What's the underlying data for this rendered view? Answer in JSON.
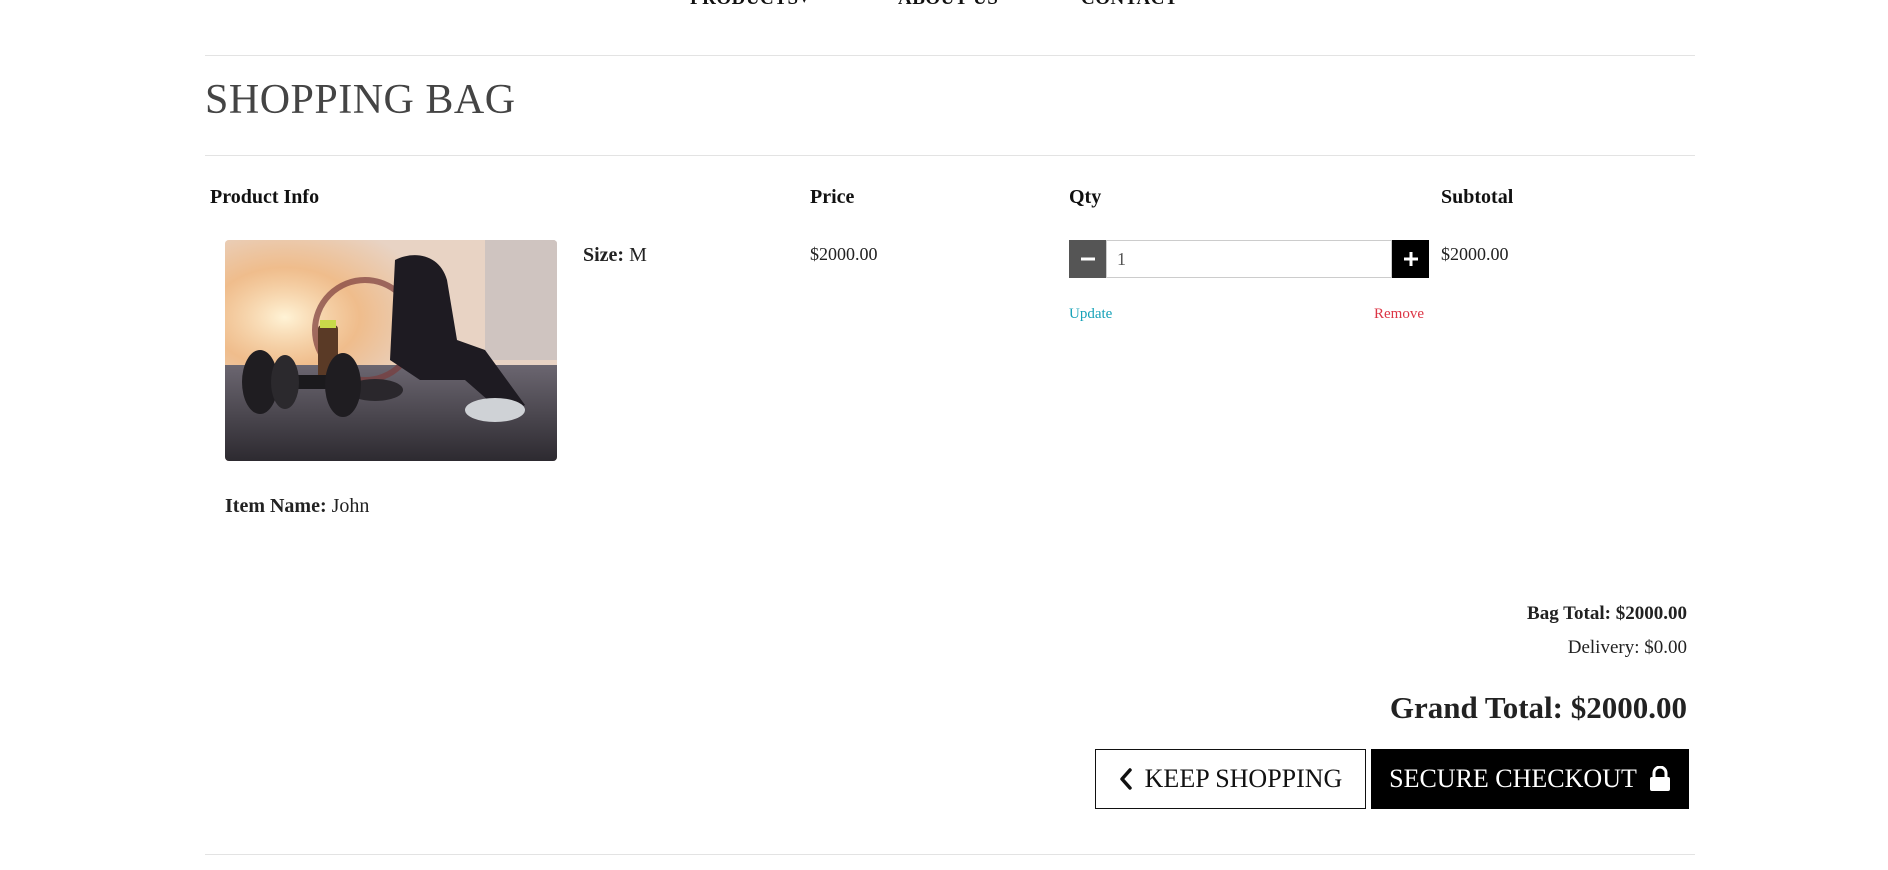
{
  "nav": {
    "items": [
      {
        "label": "PRODUCTS"
      },
      {
        "label": "ABOUT US"
      },
      {
        "label": "CONTACT"
      }
    ]
  },
  "page": {
    "title": "SHOPPING BAG"
  },
  "table": {
    "headers": {
      "product_info": "Product Info",
      "price": "Price",
      "qty": "Qty",
      "subtotal": "Subtotal"
    }
  },
  "item": {
    "size_label": "Size:",
    "size_value": "M",
    "name_label": "Item Name:",
    "name_value": "John",
    "price": "$2000.00",
    "quantity": "1",
    "subtotal": "$2000.00",
    "update_label": "Update",
    "remove_label": "Remove",
    "image_icon": "gym-workout-photo"
  },
  "summary": {
    "bag_total": "Bag Total: $2000.00",
    "delivery": "Delivery: $0.00",
    "grand_total": "Grand Total: $2000.00"
  },
  "actions": {
    "keep_shopping": "KEEP SHOPPING",
    "secure_checkout": "SECURE CHECKOUT"
  },
  "colors": {
    "update_link": "#17a2b8",
    "remove_link": "#dc3545",
    "checkout_bg": "#000000"
  }
}
